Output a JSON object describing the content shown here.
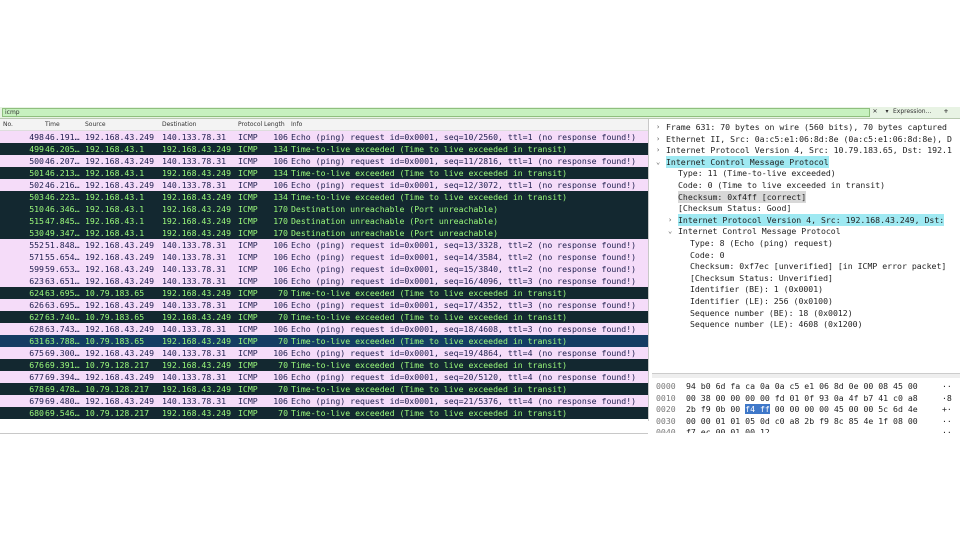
{
  "filter": {
    "value": "icmp",
    "clear": "✕",
    "dropdown": "▾",
    "expression": "Expression…",
    "add": "+"
  },
  "columns": [
    "No.",
    "Time",
    "Source",
    "Destination",
    "Protocol",
    "Length",
    "Info"
  ],
  "colors": {
    "echo_bg": "#f5dcf9",
    "echo_fg": "#1d1d4d",
    "error_bg": "#132830",
    "error_fg": "#9bfa7c",
    "unreach_bg": "#132830",
    "unreach_fg": "#9bfa7c",
    "selected_bg": "#143c63"
  },
  "packets": [
    {
      "no": "498",
      "time": "46.191…",
      "src": "192.168.43.249",
      "dst": "140.133.78.31",
      "proto": "ICMP",
      "len": "106",
      "info": "Echo (ping) request  id=0x0001, seq=10/2560, ttl=1 (no response found!)",
      "type": "echo"
    },
    {
      "no": "499",
      "time": "46.205…",
      "src": "192.168.43.1",
      "dst": "192.168.43.249",
      "proto": "ICMP",
      "len": "134",
      "info": "Time-to-live exceeded (Time to live exceeded in transit)",
      "type": "error"
    },
    {
      "no": "500",
      "time": "46.207…",
      "src": "192.168.43.249",
      "dst": "140.133.78.31",
      "proto": "ICMP",
      "len": "106",
      "info": "Echo (ping) request  id=0x0001, seq=11/2816, ttl=1 (no response found!)",
      "type": "echo"
    },
    {
      "no": "501",
      "time": "46.213…",
      "src": "192.168.43.1",
      "dst": "192.168.43.249",
      "proto": "ICMP",
      "len": "134",
      "info": "Time-to-live exceeded (Time to live exceeded in transit)",
      "type": "error"
    },
    {
      "no": "502",
      "time": "46.216…",
      "src": "192.168.43.249",
      "dst": "140.133.78.31",
      "proto": "ICMP",
      "len": "106",
      "info": "Echo (ping) request  id=0x0001, seq=12/3072, ttl=1 (no response found!)",
      "type": "echo"
    },
    {
      "no": "503",
      "time": "46.223…",
      "src": "192.168.43.1",
      "dst": "192.168.43.249",
      "proto": "ICMP",
      "len": "134",
      "info": "Time-to-live exceeded (Time to live exceeded in transit)",
      "type": "error"
    },
    {
      "no": "510",
      "time": "46.346…",
      "src": "192.168.43.1",
      "dst": "192.168.43.249",
      "proto": "ICMP",
      "len": "170",
      "info": "Destination unreachable (Port unreachable)",
      "type": "unreach"
    },
    {
      "no": "515",
      "time": "47.845…",
      "src": "192.168.43.1",
      "dst": "192.168.43.249",
      "proto": "ICMP",
      "len": "170",
      "info": "Destination unreachable (Port unreachable)",
      "type": "unreach"
    },
    {
      "no": "530",
      "time": "49.347…",
      "src": "192.168.43.1",
      "dst": "192.168.43.249",
      "proto": "ICMP",
      "len": "170",
      "info": "Destination unreachable (Port unreachable)",
      "type": "unreach"
    },
    {
      "no": "552",
      "time": "51.848…",
      "src": "192.168.43.249",
      "dst": "140.133.78.31",
      "proto": "ICMP",
      "len": "106",
      "info": "Echo (ping) request  id=0x0001, seq=13/3328, ttl=2 (no response found!)",
      "type": "echo"
    },
    {
      "no": "571",
      "time": "55.654…",
      "src": "192.168.43.249",
      "dst": "140.133.78.31",
      "proto": "ICMP",
      "len": "106",
      "info": "Echo (ping) request  id=0x0001, seq=14/3584, ttl=2 (no response found!)",
      "type": "echo"
    },
    {
      "no": "599",
      "time": "59.653…",
      "src": "192.168.43.249",
      "dst": "140.133.78.31",
      "proto": "ICMP",
      "len": "106",
      "info": "Echo (ping) request  id=0x0001, seq=15/3840, ttl=2 (no response found!)",
      "type": "echo"
    },
    {
      "no": "623",
      "time": "63.651…",
      "src": "192.168.43.249",
      "dst": "140.133.78.31",
      "proto": "ICMP",
      "len": "106",
      "info": "Echo (ping) request  id=0x0001, seq=16/4096, ttl=3 (no response found!)",
      "type": "echo"
    },
    {
      "no": "624",
      "time": "63.695…",
      "src": "10.79.183.65",
      "dst": "192.168.43.249",
      "proto": "ICMP",
      "len": "70",
      "info": "Time-to-live exceeded (Time to live exceeded in transit)",
      "type": "error"
    },
    {
      "no": "626",
      "time": "63.695…",
      "src": "192.168.43.249",
      "dst": "140.133.78.31",
      "proto": "ICMP",
      "len": "106",
      "info": "Echo (ping) request  id=0x0001, seq=17/4352, ttl=3 (no response found!)",
      "type": "echo"
    },
    {
      "no": "627",
      "time": "63.740…",
      "src": "10.79.183.65",
      "dst": "192.168.43.249",
      "proto": "ICMP",
      "len": "70",
      "info": "Time-to-live exceeded (Time to live exceeded in transit)",
      "type": "error"
    },
    {
      "no": "628",
      "time": "63.743…",
      "src": "192.168.43.249",
      "dst": "140.133.78.31",
      "proto": "ICMP",
      "len": "106",
      "info": "Echo (ping) request  id=0x0001, seq=18/4608, ttl=3 (no response found!)",
      "type": "echo"
    },
    {
      "no": "631",
      "time": "63.788…",
      "src": "10.79.183.65",
      "dst": "192.168.43.249",
      "proto": "ICMP",
      "len": "70",
      "info": "Time-to-live exceeded (Time to live exceeded in transit)",
      "type": "selected"
    },
    {
      "no": "675",
      "time": "69.300…",
      "src": "192.168.43.249",
      "dst": "140.133.78.31",
      "proto": "ICMP",
      "len": "106",
      "info": "Echo (ping) request  id=0x0001, seq=19/4864, ttl=4 (no response found!)",
      "type": "echo"
    },
    {
      "no": "676",
      "time": "69.391…",
      "src": "10.79.128.217",
      "dst": "192.168.43.249",
      "proto": "ICMP",
      "len": "70",
      "info": "Time-to-live exceeded (Time to live exceeded in transit)",
      "type": "error"
    },
    {
      "no": "677",
      "time": "69.394…",
      "src": "192.168.43.249",
      "dst": "140.133.78.31",
      "proto": "ICMP",
      "len": "106",
      "info": "Echo (ping) request  id=0x0001, seq=20/5120, ttl=4 (no response found!)",
      "type": "echo"
    },
    {
      "no": "678",
      "time": "69.478…",
      "src": "10.79.128.217",
      "dst": "192.168.43.249",
      "proto": "ICMP",
      "len": "70",
      "info": "Time-to-live exceeded (Time to live exceeded in transit)",
      "type": "error"
    },
    {
      "no": "679",
      "time": "69.480…",
      "src": "192.168.43.249",
      "dst": "140.133.78.31",
      "proto": "ICMP",
      "len": "106",
      "info": "Echo (ping) request  id=0x0001, seq=21/5376, ttl=4 (no response found!)",
      "type": "echo"
    },
    {
      "no": "680",
      "time": "69.546…",
      "src": "10.79.128.217",
      "dst": "192.168.43.249",
      "proto": "ICMP",
      "len": "70",
      "info": "Time-to-live exceeded (Time to live exceeded in transit)",
      "type": "error"
    }
  ],
  "details": [
    {
      "text": "Frame 631: 70 bytes on wire (560 bits), 70 bytes captured",
      "indent": 0,
      "arrow": "›",
      "hl": ""
    },
    {
      "text": "Ethernet II, Src: 0a:c5:e1:06:8d:8e (0a:c5:e1:06:8d:8e), D",
      "indent": 0,
      "arrow": "›",
      "hl": ""
    },
    {
      "text": "Internet Protocol Version 4, Src: 10.79.183.65, Dst: 192.1",
      "indent": 0,
      "arrow": "›",
      "hl": ""
    },
    {
      "text": "Internet Control Message Protocol",
      "indent": 0,
      "arrow": "⌄",
      "hl": "cyan"
    },
    {
      "text": "Type: 11 (Time-to-live exceeded)",
      "indent": 1,
      "arrow": "",
      "hl": ""
    },
    {
      "text": "Code: 0 (Time to live exceeded in transit)",
      "indent": 1,
      "arrow": "",
      "hl": ""
    },
    {
      "text": "Checksum: 0xf4ff [correct]",
      "indent": 1,
      "arrow": "",
      "hl": "grey"
    },
    {
      "text": "[Checksum Status: Good]",
      "indent": 1,
      "arrow": "",
      "hl": ""
    },
    {
      "text": "Internet Protocol Version 4, Src: 192.168.43.249, Dst:",
      "indent": 1,
      "arrow": "›",
      "hl": "cyan"
    },
    {
      "text": "Internet Control Message Protocol",
      "indent": 1,
      "arrow": "⌄",
      "hl": ""
    },
    {
      "text": "Type: 8 (Echo (ping) request)",
      "indent": 2,
      "arrow": "",
      "hl": ""
    },
    {
      "text": "Code: 0",
      "indent": 2,
      "arrow": "",
      "hl": ""
    },
    {
      "text": "Checksum: 0xf7ec [unverified] [in ICMP error packet]",
      "indent": 2,
      "arrow": "",
      "hl": ""
    },
    {
      "text": "[Checksum Status: Unverified]",
      "indent": 2,
      "arrow": "",
      "hl": ""
    },
    {
      "text": "Identifier (BE): 1 (0x0001)",
      "indent": 2,
      "arrow": "",
      "hl": ""
    },
    {
      "text": "Identifier (LE): 256 (0x0100)",
      "indent": 2,
      "arrow": "",
      "hl": ""
    },
    {
      "text": "Sequence number (BE): 18 (0x0012)",
      "indent": 2,
      "arrow": "",
      "hl": ""
    },
    {
      "text": "Sequence number (LE): 4608 (0x1200)",
      "indent": 2,
      "arrow": "",
      "hl": ""
    }
  ],
  "bytes": [
    {
      "off": "0000",
      "pre": "94 b0 6d fa ca 0a 0a c5  e1 06 8d 0e 00 08 45 00",
      "sel": "",
      "post": "",
      "ascii": "··"
    },
    {
      "off": "0010",
      "pre": "00 38 00 00 00 00 fd 01  0f 93 0a 4f b7 41 c0 a8",
      "sel": "",
      "post": "",
      "ascii": "·8"
    },
    {
      "off": "0020",
      "pre": "2b f9 0b 00 ",
      "sel": "f4 ff",
      "post": " 00 00  00 00 45 00 00 5c 6d 4e",
      "ascii": "+·"
    },
    {
      "off": "0030",
      "pre": "00 00 01 01 05 0d c0 a8  2b f9 8c 85 4e 1f 08 00",
      "sel": "",
      "post": "",
      "ascii": "··"
    },
    {
      "off": "0040",
      "pre": "f7 ec 00 01 00 12",
      "sel": "",
      "post": "",
      "ascii": "··"
    }
  ]
}
